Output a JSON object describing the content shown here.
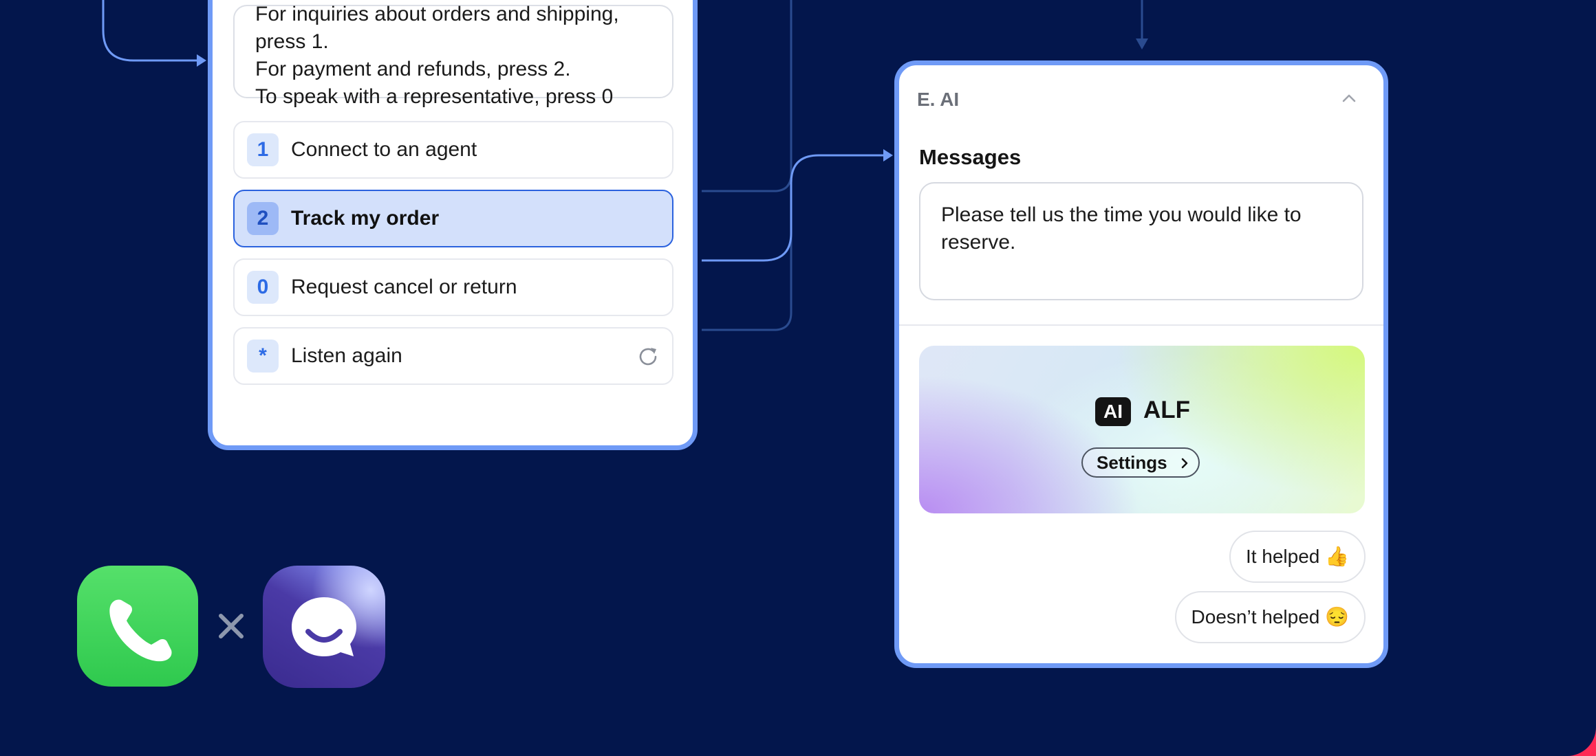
{
  "ivr": {
    "prompt_lines": [
      "For inquiries about orders and shipping,",
      "press 1.",
      "For payment and refunds, press 2.",
      "To speak with a representative, press 0"
    ],
    "options": [
      {
        "key": "1",
        "label": "Connect to an agent",
        "selected": false
      },
      {
        "key": "2",
        "label": "Track my order",
        "selected": true
      },
      {
        "key": "0",
        "label": "Request cancel or return",
        "selected": false
      },
      {
        "key": "*",
        "label": "Listen again",
        "selected": false,
        "icon": "refresh-icon"
      }
    ]
  },
  "ai_node": {
    "title": "E. AI",
    "messages_heading": "Messages",
    "message": "Please tell us the time you would like to reserve.",
    "alf": {
      "badge": "AI",
      "name": "ALF",
      "settings_label": "Settings",
      "settings_icon": "chevron-right-icon"
    },
    "feedback": [
      {
        "label": "It helped 👍"
      },
      {
        "label": "Doesn’t helped 😔"
      }
    ]
  },
  "logos": {
    "left": "phone-icon",
    "separator": "×",
    "right": "chat-app-icon"
  },
  "colors": {
    "background": "#03164c",
    "accent_border": "#6f9af6",
    "selected_fill": "#d3e0fb",
    "key_badge": "#dde8fb",
    "wire_active": "#6f9af6",
    "wire_dim": "#2a4b8f",
    "phone_green": "#34c759",
    "corner_accent": "#ff2a55"
  }
}
